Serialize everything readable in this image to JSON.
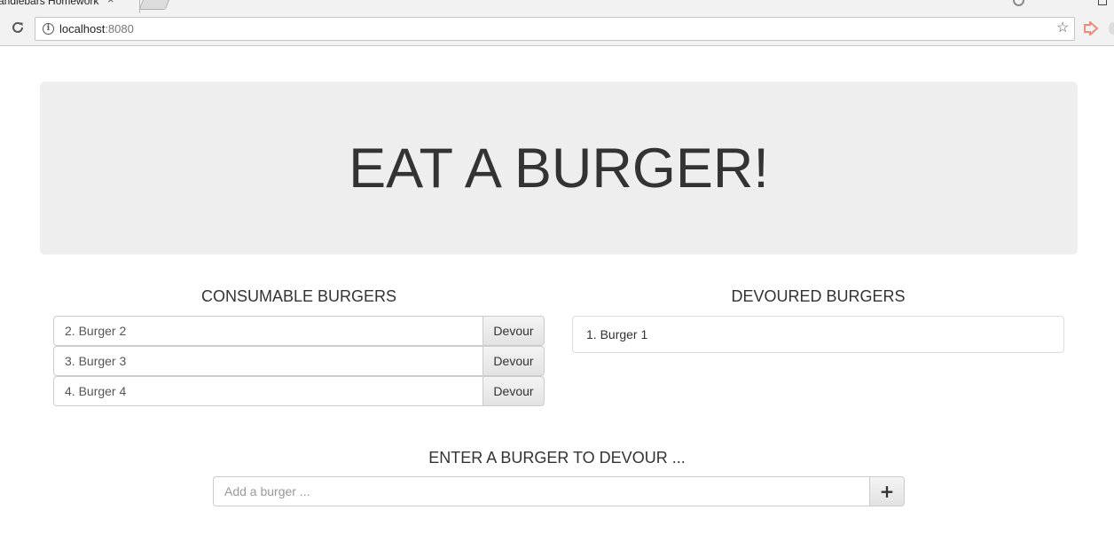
{
  "browser": {
    "tab_title": "andlebars Homework",
    "tab_close": "×",
    "url_host": "localhost",
    "url_port": ":8080",
    "bookmark_star": "☆"
  },
  "page": {
    "title": "EAT A BURGER!",
    "consumable_heading": "CONSUMABLE BURGERS",
    "devoured_heading": "DEVOURED BURGERS",
    "devour_label": "Devour",
    "consumable": [
      {
        "name": "2. Burger 2"
      },
      {
        "name": "3. Burger 3"
      },
      {
        "name": "4. Burger 4"
      }
    ],
    "devoured": [
      {
        "name": "1. Burger 1"
      }
    ],
    "add_heading": "ENTER A BURGER TO DEVOUR ...",
    "add_placeholder": "Add a burger ...",
    "add_button": "+"
  }
}
